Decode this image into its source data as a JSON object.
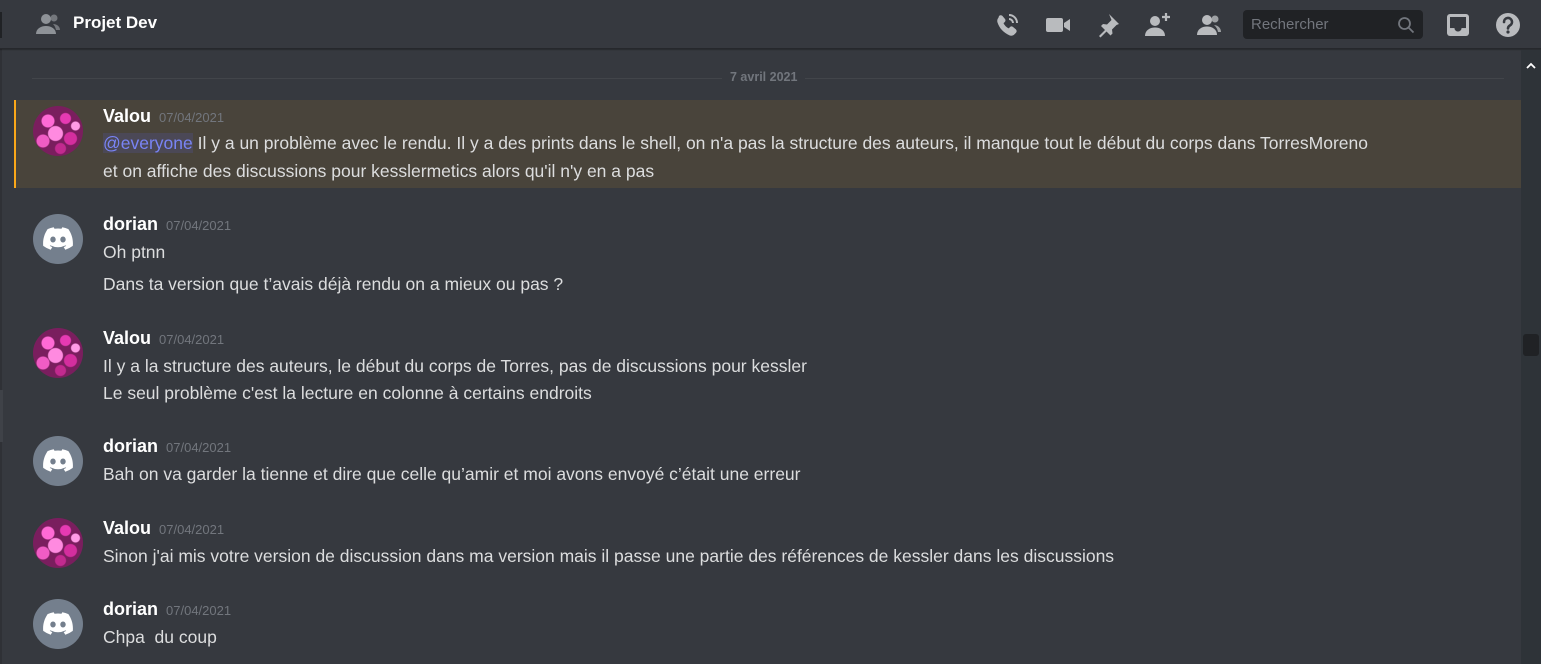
{
  "header": {
    "title": "Projet Dev",
    "search_placeholder": "Rechercher",
    "icons": [
      "group-icon",
      "call-icon",
      "video-icon",
      "pin-icon",
      "add-member-icon",
      "members-icon",
      "search-icon",
      "inbox-icon",
      "help-icon"
    ]
  },
  "divider": {
    "date": "7 avril 2021"
  },
  "messages": [
    {
      "author": "Valou",
      "timestamp": "07/04/2021",
      "mention": "@everyone",
      "lines": [
        " Il y a un problème avec le rendu. Il y a des prints dans le shell, on n'a pas la structure des auteurs, il manque tout le début du corps dans TorresMoreno",
        "et on affiche des discussions pour kesslermetics alors qu'il n'y en a pas"
      ]
    },
    {
      "author": "dorian",
      "timestamp": "07/04/2021",
      "lines": [
        "Oh ptnn",
        "Dans ta version que t’avais déjà rendu on a mieux ou pas ?"
      ]
    },
    {
      "author": "Valou",
      "timestamp": "07/04/2021",
      "lines": [
        "Il y a la structure des auteurs, le début du corps de Torres, pas de discussions pour kessler",
        "Le seul problème c'est la lecture en colonne à certains endroits"
      ]
    },
    {
      "author": "dorian",
      "timestamp": "07/04/2021",
      "lines": [
        "Bah on va garder la tienne et dire que celle qu’amir et moi avons envoyé c’était une erreur"
      ]
    },
    {
      "author": "Valou",
      "timestamp": "07/04/2021",
      "lines": [
        "Sinon j'ai mis votre version de discussion dans ma version mais il passe une partie des références de kessler dans les discussions"
      ]
    },
    {
      "author": "dorian",
      "timestamp": "07/04/2021",
      "lines": [
        "Chpa  du coup"
      ]
    }
  ],
  "colors": {
    "background": "#36393f",
    "mention_highlight": "#faa81a",
    "mention_text": "#7984f5",
    "default_avatar": "#747f8d"
  }
}
